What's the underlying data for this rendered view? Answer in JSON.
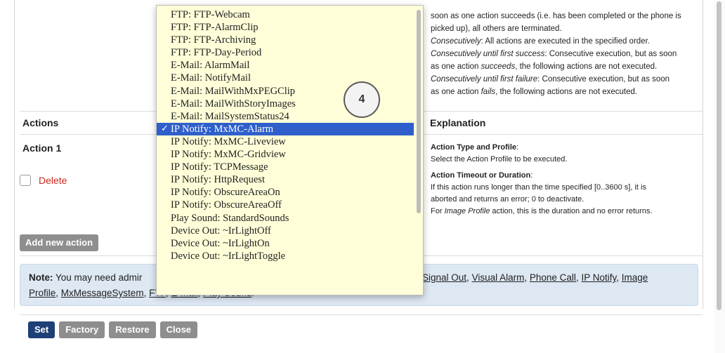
{
  "explanation_top": {
    "line1": "soon as one action succeeds (i.e. has been completed or the phone is",
    "line2": "picked up), all others are terminated.",
    "consecutively_term": "Consecutively",
    "consecutively_text": ": All actions are executed in the specified order.",
    "until_success_term": "Consecutively until first success",
    "until_success_text": ": Consecutive execution, but as soon",
    "until_success_line2_a": "as one action ",
    "until_success_line2_em": "succeeds",
    "until_success_line2_b": ", the following actions are not executed.",
    "until_failure_term": "Consecutively until first failure",
    "until_failure_text": ": Consecutive execution, but as soon",
    "until_failure_line2_a": "as one action ",
    "until_failure_line2_em": "fails",
    "until_failure_line2_b": ", the following actions are not executed."
  },
  "table_header": {
    "actions": "Actions",
    "explanation": "Explanation"
  },
  "action_block": {
    "title": "Action 1",
    "delete_label": "Delete",
    "explain_type_title": "Action Type and Profile",
    "explain_type_colon": ":",
    "explain_type_text": "Select the Action Profile to be executed.",
    "explain_timeout_title": "Action Timeout or Duration",
    "explain_timeout_colon": ":",
    "explain_timeout_line1": "If this action runs longer than the time specified [0..3600 s], it is",
    "explain_timeout_line2": "aborted and returns an error; 0 to deactivate.",
    "explain_image_prefix": "For ",
    "explain_image_em": "Image Profile",
    "explain_image_suffix": " action, this is the duration and no error returns."
  },
  "add_action_label": "Add new action",
  "note": {
    "prefix": "Note:",
    "text_a": " You may need admir",
    "links_visible": [
      "Signal Out",
      "Visual Alarm",
      "Phone Call",
      "IP Notify",
      "Image"
    ],
    "link_profile": "Profile",
    "link_mxmessage": "MxMessageSystem",
    "sep": ", ",
    "link_ftp_partial": "FTP",
    "link_email_partial": "E-Mail",
    "link_playsound_partial": "Play Sound",
    "end": "."
  },
  "footer": {
    "set": "Set",
    "factory": "Factory",
    "restore": "Restore",
    "close": "Close"
  },
  "dropdown": {
    "check_glyph": "✓",
    "items": [
      "FTP: FTP-Webcam",
      "FTP: FTP-AlarmClip",
      "FTP: FTP-Archiving",
      "FTP: FTP-Day-Period",
      "E-Mail: AlarmMail",
      "E-Mail: NotifyMail",
      "E-Mail: MailWithMxPEGClip",
      "E-Mail: MailWithStoryImages",
      "E-Mail: MailSystemStatus24",
      "IP Notify: MxMC-Alarm",
      "IP Notify: MxMC-Liveview",
      "IP Notify: MxMC-Gridview",
      "IP Notify: TCPMessage",
      "IP Notify: HttpRequest",
      "IP Notify: ObscureAreaOn",
      "IP Notify: ObscureAreaOff",
      "Play Sound: StandardSounds",
      "Device Out: ~IrLightOff",
      "Device Out: ~IrLightOn",
      "Device Out: ~IrLightToggle"
    ],
    "selected_index": 9
  },
  "step_badge": "4",
  "colors": {
    "dropdown_bg": "#fffed8",
    "selected_bg": "#2e5fcb",
    "delete_red": "#cc2a1f",
    "set_button": "#1f3f77",
    "note_bg": "#dde8f3"
  }
}
